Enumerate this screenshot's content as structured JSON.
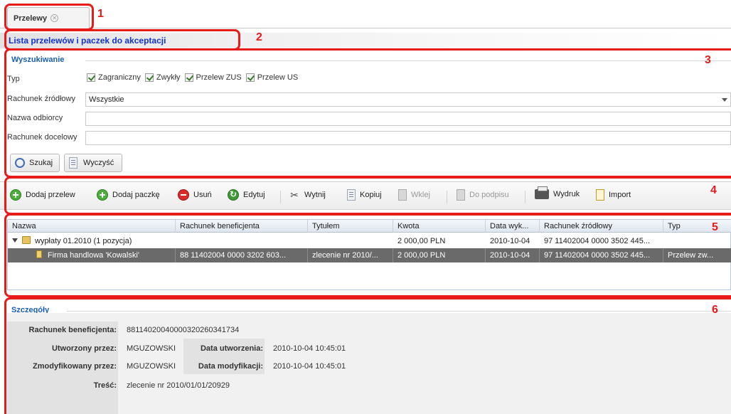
{
  "tab": {
    "label": "Przelewy"
  },
  "page_title": "Lista przelewów i paczek do akceptacji",
  "search": {
    "legend": "Wyszukiwanie",
    "type_label": "Typ",
    "types": [
      "Zagraniczny",
      "Zwykły",
      "Przelew ZUS",
      "Przelew US"
    ],
    "source_account_label": "Rachunek źródłowy",
    "source_account_value": "Wszystkie",
    "recipient_label": "Nazwa odbiorcy",
    "recipient_value": "",
    "target_account_label": "Rachunek docelowy",
    "target_account_value": "",
    "search_button": "Szukaj",
    "clear_button": "Wyczyść"
  },
  "toolbar": {
    "add_transfer": "Dodaj przelew",
    "add_package": "Dodaj paczkę",
    "delete": "Usuń",
    "edit": "Edytuj",
    "cut": "Wytnij",
    "copy": "Kopiuj",
    "paste": "Wklej",
    "to_sign": "Do podpisu",
    "print": "Wydruk",
    "import": "Import"
  },
  "grid": {
    "columns": [
      "Nazwa",
      "Rachunek beneficjenta",
      "Tytułem",
      "Kwota",
      "Data wyk...",
      "Rachunek źródłowy",
      "Typ"
    ],
    "rows": [
      {
        "name": "wypłaty 01.2010 (1 pozycja)",
        "beneficiary_account": "",
        "title": "",
        "amount": "2 000,00 PLN",
        "date": "2010-10-04",
        "source_account": "97 11402004 0000 3502 445...",
        "type": ""
      },
      {
        "name": "Firma handlowa 'Kowalski'",
        "beneficiary_account": "88 11402004 0000 3202 603...",
        "title": "zlecenie nr 2010/...",
        "amount": "2 000,00 PLN",
        "date": "2010-10-04",
        "source_account": "97 11402004 0000 3502 445...",
        "type": "Przelew zw..."
      }
    ]
  },
  "details": {
    "legend": "Szczegóły",
    "beneficiary_label": "Rachunek beneficjenta:",
    "beneficiary_value": "88114020040000320260341734",
    "created_by_label": "Utworzony przez:",
    "created_by_value": "MGUZOWSKI",
    "created_date_label": "Data utworzenia:",
    "created_date_value": "2010-10-04 10:45:01",
    "modified_by_label": "Zmodyfikowany przez:",
    "modified_by_value": "MGUZOWSKI",
    "modified_date_label": "Data modyfikacji:",
    "modified_date_value": "2010-10-04 10:45:01",
    "content_label": "Treść:",
    "content_value": "zlecenie nr 2010/01/01/20929"
  },
  "annotations": [
    "1",
    "2",
    "3",
    "4",
    "5",
    "6"
  ],
  "colors": {
    "annotation": "#e81a1a",
    "title": "#1133cc",
    "legend": "#1a5fb4",
    "selected_row": "#6a6a6a"
  }
}
